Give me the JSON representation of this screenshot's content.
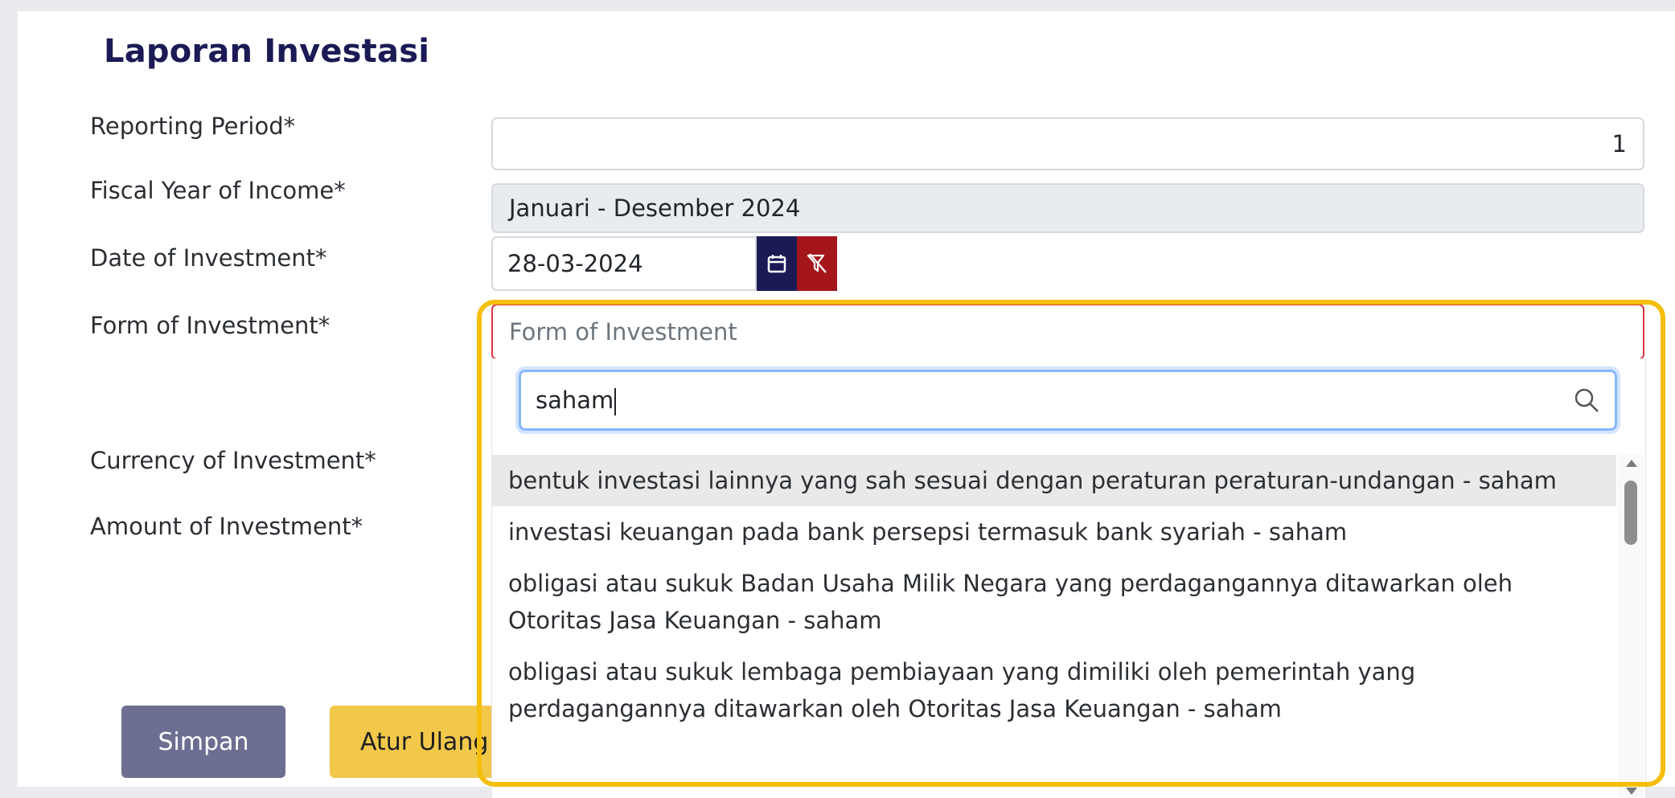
{
  "form": {
    "title": "Laporan Investasi",
    "fields": {
      "reporting_period": {
        "label": "Reporting Period*",
        "value": "1"
      },
      "fiscal_year": {
        "label": "Fiscal Year of Income*",
        "value": "Januari - Desember 2024"
      },
      "date_of_investment": {
        "label": "Date of Investment*",
        "value": "28-03-2024"
      },
      "form_of_investment": {
        "label": "Form of Investment*",
        "placeholder": "Form of Investment"
      },
      "currency": {
        "label": "Currency of Investment*"
      },
      "amount": {
        "label": "Amount of Investment*"
      }
    },
    "buttons": {
      "save": "Simpan",
      "reset": "Atur Ulang"
    }
  },
  "dropdown": {
    "search_value": "saham",
    "options": [
      "bentuk investasi lainnya yang sah sesuai dengan peraturan peraturan-undangan - saham",
      "investasi keuangan pada bank persepsi termasuk bank syariah - saham",
      "obligasi atau sukuk Badan Usaha Milik Negara yang perdagangannya ditawarkan oleh Otoritas Jasa Keuangan - saham",
      "obligasi atau sukuk lembaga pembiayaan yang dimiliki oleh pemerintah yang perdagangannya ditawarkan oleh Otoritas Jasa Keuangan - saham"
    ]
  },
  "icons": {
    "calendar": "calendar-icon",
    "clear": "filter-clear-icon",
    "search": "search-icon"
  },
  "colors": {
    "title": "#1b1a55",
    "calendar_button": "#1b1a55",
    "clear_button": "#a4161a",
    "invalid_border": "#dc3545",
    "focus_border": "#86b7fe",
    "save_button": "#6c6f91",
    "reset_button": "#f2c84b",
    "highlight": "#f5be0b"
  }
}
